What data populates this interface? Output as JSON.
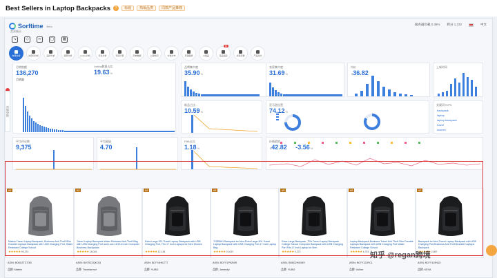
{
  "header": {
    "title": "Best Sellers in Laptop Backpacks",
    "tags": [
      "标题",
      "热销品类",
      "同款产品推荐"
    ],
    "help_glyph": "?"
  },
  "sorftime": {
    "logo": "Sorftime",
    "logo_sub": "Beta",
    "store_id": "卖家精灵",
    "right_info": [
      "服务器负载 0.38%",
      "积分 1,332",
      "中文"
    ],
    "tools": [
      "tool-icon-1",
      "tool-icon-2",
      "tool-icon-3",
      "tool-icon-4",
      "tool-icon-5"
    ],
    "functions": [
      {
        "label": "市场分析",
        "active": true
      },
      {
        "label": "关键词分析"
      },
      {
        "label": "品牌分析"
      },
      {
        "label": "卖家分析"
      },
      {
        "label": "Listing分析"
      },
      {
        "label": "评论分析"
      },
      {
        "label": "利润计算"
      },
      {
        "label": "历史数据"
      },
      {
        "label": "上架时间"
      },
      {
        "label": "价格分布"
      },
      {
        "label": "月销趋势"
      },
      {
        "label": "AI选品"
      },
      {
        "label": "竞品追踪",
        "badge": "新"
      },
      {
        "label": "关联流量"
      },
      {
        "label": "产品对比"
      }
    ],
    "side_tab": "市场分析"
  },
  "metrics": {
    "m1": {
      "label": "月销售额",
      "value": "136,270",
      "sub": "月销量"
    },
    "m2": {
      "label": "Listing数量占比",
      "value": "19.63",
      "unit": "%"
    },
    "m3": {
      "label": "品牌集中度",
      "value": "35.90",
      "unit": "%"
    },
    "m4": {
      "label": "卖家集中度",
      "value": "31.69",
      "unit": "%"
    },
    "m5": {
      "label": "均价",
      "value": "36.82",
      "prefix": "$"
    },
    "m6": {
      "label": "上架时间"
    },
    "m7": {
      "label": "新品占比",
      "value": "10.59",
      "unit": "%"
    },
    "m8": {
      "label": "亚马逊自营",
      "value": "74.12",
      "unit": "%"
    },
    "m9": {
      "label": "关键词TOP5",
      "words": [
        "backpack",
        "laptop",
        "laptop backpack",
        "travel",
        "women"
      ]
    },
    "m10": {
      "label": "平均评论数",
      "value": "9,375"
    },
    "m11": {
      "label": "平均星级",
      "value": "4.70"
    },
    "m12": {
      "label": "FBA占比",
      "value": "1.18",
      "unit": "%"
    },
    "m13": {
      "label": "价格趋势",
      "value": "42.82",
      "delta": "-3.56",
      "unit": "%",
      "prefix": "$"
    }
  },
  "products": [
    {
      "rank": "#1",
      "title": "Matein Travel Laptop Backpack, Business Anti Theft Slim Durable Laptops Backpack with USB Charging Port, Water Resistant College School",
      "stars": "★★★★★",
      "rating": "93,374",
      "asin": "ASIN: B06XZTZ7GB",
      "brand": "品牌: Matein"
    },
    {
      "rank": "#2",
      "title": "Travel Laptop Backpack Water Resistant Anti-Theft Bag with USB Charging Port and Lock 14/15.6 Inch Computer Business Backpacks",
      "stars": "★★★★★",
      "rating": "18,045",
      "asin": "ASIN: B07SZ2QKGQ",
      "brand": "品牌: Travelarmor"
    },
    {
      "rank": "#3",
      "title": "Extra Large 52L Travel Laptop Backpack with USB Charging Port, Fits 17 Inch Laptops for Men Women",
      "stars": "★★★★★",
      "rating": "12,136",
      "asin": "ASIN: B07Y4HKZT7",
      "brand": "品牌: YUBG"
    },
    {
      "rank": "#4",
      "title": "TORBAG Backpack for Men,Extra Large 50L Travel Laptop Backpack with USB Charging Port,17 Inch Laptop Bag",
      "stars": "★★★★★",
      "rating": "24,067",
      "asin": "ASIN: B07Y1P9ZMR",
      "brand": "品牌: Jamesky"
    },
    {
      "rank": "#5",
      "title": "Extra Large Backpack, TSA Travel Laptop Backpack College School Computer Backpack with USB Charging Port Fits 17 Inch Laptop for Men",
      "stars": "★★★★★",
      "rating": "9,270",
      "asin": "ASIN: B08G2H4V6S",
      "brand": "品牌: YUBG"
    },
    {
      "rank": "#6",
      "title": "Laptop Backpack Business Travel Anti Theft Slim Durable Laptops Backpack with USB Charging Port Water Resistant College School",
      "stars": "★★★★★",
      "rating": "4,376",
      "asin": "ASIN: B07Y12JRCL",
      "brand": "品牌: Volher"
    },
    {
      "rank": "#7",
      "title": "Backpack for Men,Travel Laptop Backpack with USB Charging Port,Business Anti Theft Durable Laptops Backpack",
      "stars": "★★★★★",
      "rating": "2,887",
      "asin": "ASIN: B07Y1J9N15",
      "brand": "品牌: KEVA"
    }
  ],
  "watermark": "知乎 @regan跨境",
  "colors": {
    "accent": "#2a6fd6",
    "highlight_border": "#d8333a",
    "rank_badge": "#b8721a"
  }
}
